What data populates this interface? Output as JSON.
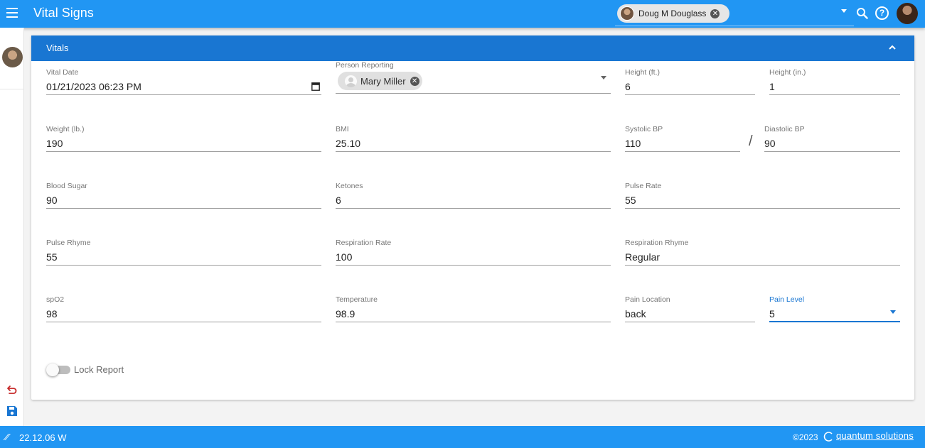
{
  "app": {
    "title": "Vital Signs",
    "menu_icon": "hamburger-menu-icon",
    "patient_name": "Doug M Douglass",
    "icons": [
      "search-icon",
      "help-icon"
    ]
  },
  "card": {
    "title": "Vitals"
  },
  "fields": {
    "vital_date": {
      "label": "Vital Date",
      "value": "01/21/2023 06:23 PM"
    },
    "person_reporting": {
      "label": "Person Reporting",
      "value": "Mary Miller"
    },
    "height_ft": {
      "label": "Height (ft.)",
      "value": "6"
    },
    "height_in": {
      "label": "Height (in.)",
      "value": "1"
    },
    "weight": {
      "label": "Weight (lb.)",
      "value": "190"
    },
    "bmi": {
      "label": "BMI",
      "value": "25.10"
    },
    "systolic": {
      "label": "Systolic BP",
      "value": "110"
    },
    "diastolic": {
      "label": "Diastolic BP",
      "value": "90"
    },
    "bp_separator": "/",
    "blood_sugar": {
      "label": "Blood Sugar",
      "value": "90"
    },
    "ketones": {
      "label": "Ketones",
      "value": "6"
    },
    "pulse_rate": {
      "label": "Pulse Rate",
      "value": "55"
    },
    "pulse_rhyme": {
      "label": "Pulse Rhyme",
      "value": "55"
    },
    "respiration_rate": {
      "label": "Respiration Rate",
      "value": "100"
    },
    "respiration_rhyme": {
      "label": "Respiration Rhyme",
      "value": "Regular"
    },
    "spo2": {
      "label": "spO2",
      "value": "98"
    },
    "temperature": {
      "label": "Temperature",
      "value": "98.9"
    },
    "pain_location": {
      "label": "Pain Location",
      "value": "back"
    },
    "pain_level": {
      "label": "Pain Level",
      "value": "5"
    }
  },
  "lock_report": {
    "label": "Lock Report",
    "checked": false
  },
  "footer": {
    "version": "22.12.06 W",
    "copyright": "©2023",
    "brand": "quantum solutions"
  },
  "colors": {
    "app_bar": "#2196f3",
    "card_header": "#1976d2",
    "background": "#f3f3f3"
  }
}
